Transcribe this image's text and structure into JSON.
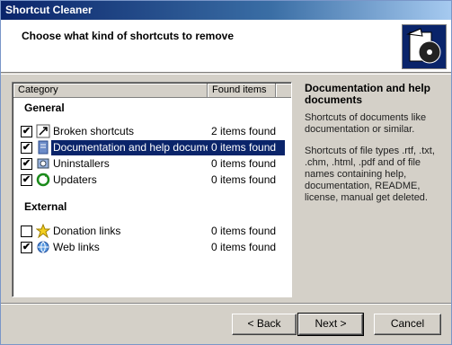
{
  "window": {
    "title": "Shortcut Cleaner"
  },
  "header": {
    "title": "Choose what kind of shortcuts to remove",
    "logo_icon": "shortcut-cleaner-logo"
  },
  "list": {
    "columns": [
      "Category",
      "Found items"
    ],
    "groups": [
      {
        "label": "General",
        "items": [
          {
            "label": "Broken shortcuts",
            "found": "2 items found",
            "checked": true,
            "icon": "broken-shortcut-icon"
          },
          {
            "label": "Documentation and help documents",
            "found": "0 items found",
            "checked": true,
            "icon": "document-icon",
            "selected": true
          },
          {
            "label": "Uninstallers",
            "found": "0 items found",
            "checked": true,
            "icon": "uninstaller-icon"
          },
          {
            "label": "Updaters",
            "found": "0 items found",
            "checked": true,
            "icon": "updater-icon"
          }
        ]
      },
      {
        "label": "External",
        "items": [
          {
            "label": "Donation links",
            "found": "0 items found",
            "checked": false,
            "icon": "star-icon"
          },
          {
            "label": "Web links",
            "found": "0 items found",
            "checked": true,
            "icon": "web-link-icon"
          }
        ]
      }
    ]
  },
  "description": {
    "title": "Documentation and help documents",
    "paragraph1": "Shortcuts of documents like documentation or similar.",
    "paragraph2": "Shortcuts of file types .rtf, .txt, .chm, .html, .pdf and of file names containing help, documentation, README, license, manual get deleted."
  },
  "buttons": {
    "back": "< Back",
    "next": "Next >",
    "cancel": "Cancel"
  }
}
